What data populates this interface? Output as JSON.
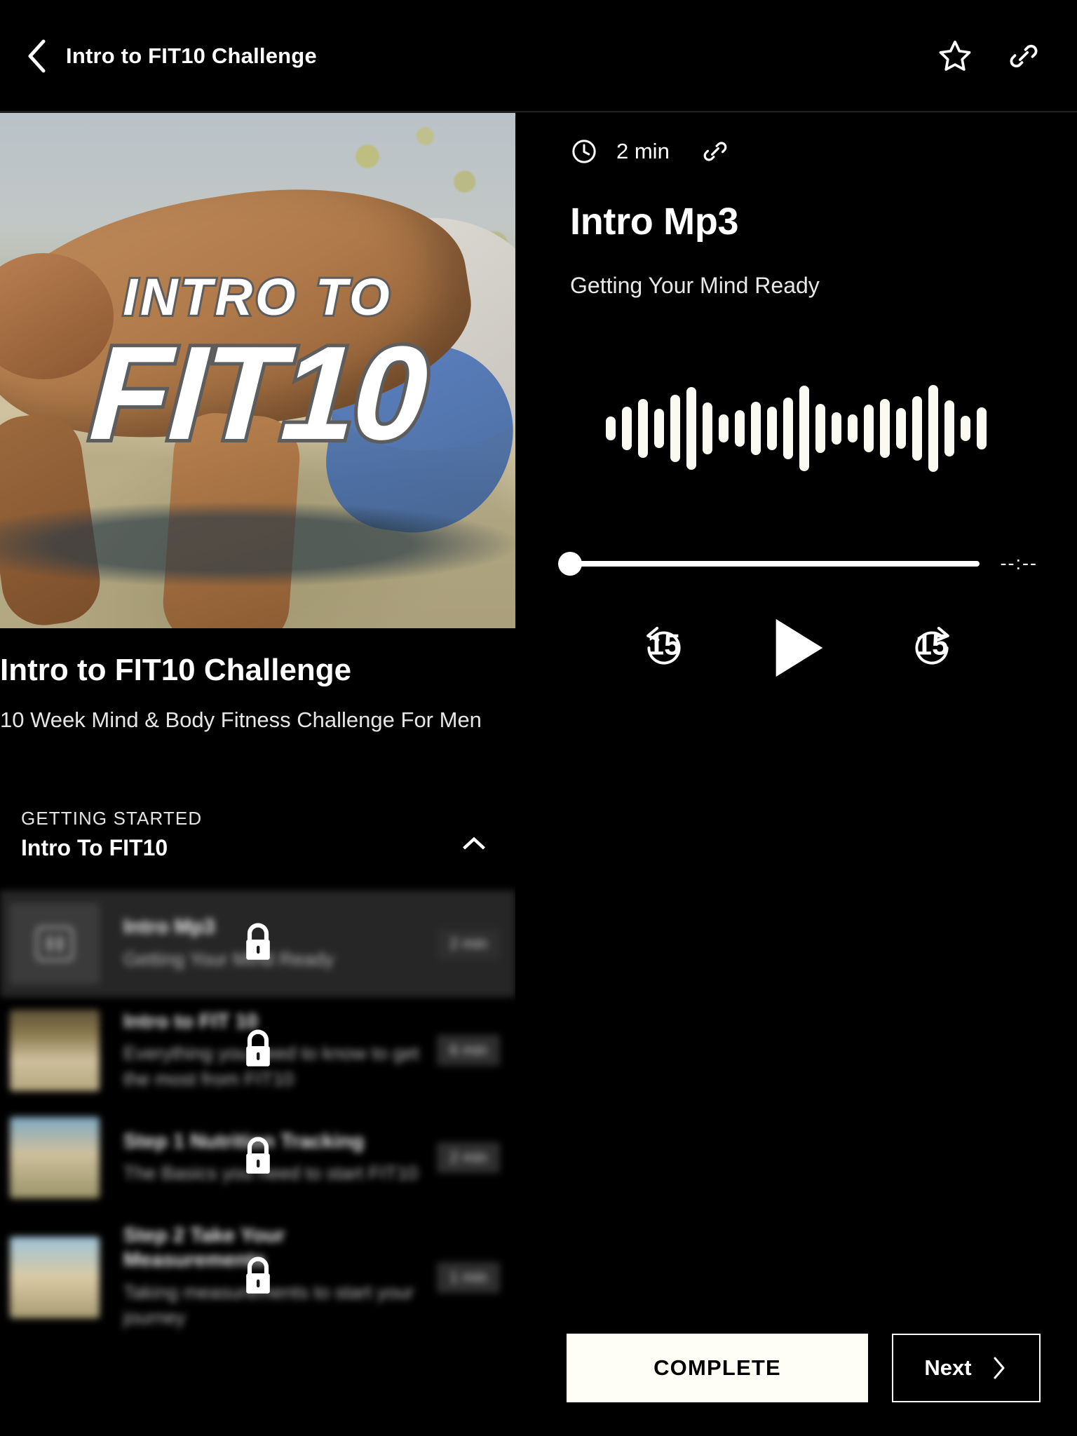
{
  "topbar": {
    "title": "Intro to FIT10 Challenge",
    "back_icon": "chevron-left-icon",
    "favorite_icon": "star-outline-icon",
    "share_icon": "link-icon"
  },
  "course": {
    "hero_overlay_line1": "INTRO TO",
    "hero_overlay_line2": "FIT10",
    "title": "Intro to FIT10 Challenge",
    "subtitle": "10 Week Mind & Body Fitness Challenge For Men"
  },
  "section": {
    "label": "GETTING STARTED",
    "name": "Intro To FIT10",
    "collapse_icon": "chevron-up-icon"
  },
  "lessons": [
    {
      "title": "Intro Mp3",
      "desc": "Getting Your Mind Ready",
      "duration": "2 min",
      "locked": true,
      "active": true,
      "thumb_icon": "audio-book-icon"
    },
    {
      "title": "Intro to FIT 10",
      "desc": "Everything you need to know to get the most from FIT10",
      "duration": "6 min",
      "locked": true,
      "active": false,
      "thumb_icon": "video-thumbnail"
    },
    {
      "title": "Step 1 Nutrition Tracking",
      "desc": "The Basics you need to start FIT10",
      "duration": "2 min",
      "locked": true,
      "active": false,
      "thumb_icon": "video-thumbnail"
    },
    {
      "title": "Step 2 Take Your Measurements",
      "desc": "Taking measurements to start your journey",
      "duration": "1 min",
      "locked": true,
      "active": false,
      "thumb_icon": "video-thumbnail"
    }
  ],
  "player": {
    "clock_icon": "clock-icon",
    "duration": "2 min",
    "share_icon": "link-icon",
    "title": "Intro Mp3",
    "subtitle": "Getting Your Mind Ready",
    "elapsed_time": "--:--",
    "progress_percent": 0,
    "rewind_label": "15",
    "forward_label": "15",
    "play_icon": "play-icon",
    "rewind_icon": "rewind-15-icon",
    "forward_icon": "forward-15-icon",
    "waveform": [
      34,
      62,
      84,
      56,
      96,
      118,
      74,
      40,
      52,
      76,
      62,
      88,
      122,
      70,
      46,
      40,
      68,
      84,
      58,
      92,
      124,
      80,
      36,
      60
    ],
    "waveform_color": "#FBFAF2"
  },
  "actions": {
    "complete_label": "COMPLETE",
    "next_label": "Next",
    "next_icon": "chevron-right-icon",
    "complete_bg": "#FFFEF6"
  }
}
